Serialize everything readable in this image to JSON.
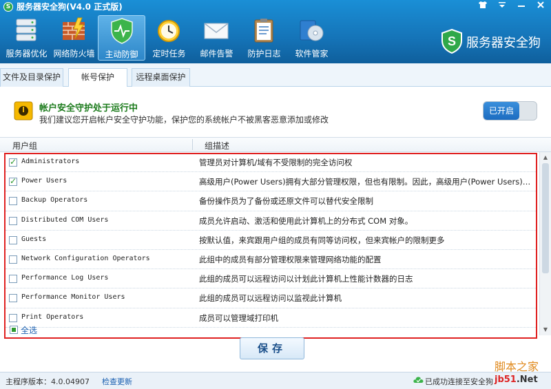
{
  "window": {
    "title": "服务器安全狗(V4.0 正式版)",
    "logo_letter": "S",
    "controls": [
      "shirt-icon",
      "menu-icon",
      "minimize-icon",
      "close-icon"
    ]
  },
  "toolbar": {
    "items": [
      {
        "label": "服务器优化",
        "icon": "server-icon"
      },
      {
        "label": "网络防火墙",
        "icon": "firewall-icon"
      },
      {
        "label": "主动防御",
        "icon": "shield-icon",
        "active": true
      },
      {
        "label": "定时任务",
        "icon": "clock-icon"
      },
      {
        "label": "邮件告警",
        "icon": "mail-icon"
      },
      {
        "label": "防护日志",
        "icon": "log-icon"
      },
      {
        "label": "软件管家",
        "icon": "software-icon"
      }
    ]
  },
  "brand": {
    "text": "服务器安全狗",
    "icon": "brand-shield-icon"
  },
  "tabs": [
    {
      "label": "文件及目录保护",
      "active": false
    },
    {
      "label": "帐号保护",
      "active": true
    },
    {
      "label": "远程桌面保护",
      "active": false
    }
  ],
  "banner": {
    "title": "帐户安全守护处于运行中",
    "description": "我们建议您开启帐户安全守护功能，保护您的系统帐户不被黑客恶意添加或修改",
    "toggle_label": "已开启",
    "enabled": true
  },
  "table": {
    "columns": [
      "用户组",
      "组描述"
    ],
    "rows": [
      {
        "name": "Administrators",
        "desc": "管理员对计算机/域有不受限制的完全访问权",
        "checked": true
      },
      {
        "name": "Power Users",
        "desc": "高级用户(Power Users)拥有大部分管理权限，但也有限制。因此，高级用户(Power Users)可以…",
        "checked": true
      },
      {
        "name": "Backup Operators",
        "desc": "备份操作员为了备份或还原文件可以替代安全限制",
        "checked": false
      },
      {
        "name": "Distributed COM Users",
        "desc": "成员允许启动、激活和使用此计算机上的分布式 COM 对象。",
        "checked": false
      },
      {
        "name": "Guests",
        "desc": "按默认值，来宾跟用户组的成员有同等访问权，但来宾帐户的限制更多",
        "checked": false
      },
      {
        "name": "Network Configuration Operators",
        "desc": "此组中的成员有部分管理权限来管理网络功能的配置",
        "checked": false
      },
      {
        "name": "Performance Log Users",
        "desc": "此组的成员可以远程访问以计划此计算机上性能计数器的日志",
        "checked": false
      },
      {
        "name": "Performance Monitor Users",
        "desc": "此组的成员可以远程访问以监视此计算机",
        "checked": false
      },
      {
        "name": "Print Operators",
        "desc": "成员可以管理域打印机",
        "checked": false
      }
    ]
  },
  "select_all": {
    "label": "全选"
  },
  "save_button": {
    "label": "保存"
  },
  "watermark": "脚本之家",
  "statusbar": {
    "version": "主程序版本：4.0.04907",
    "update_link": "检查更新",
    "connection": "已成功连接至安全狗",
    "site_prefix": "jb51",
    "site_suffix": ".Net"
  }
}
